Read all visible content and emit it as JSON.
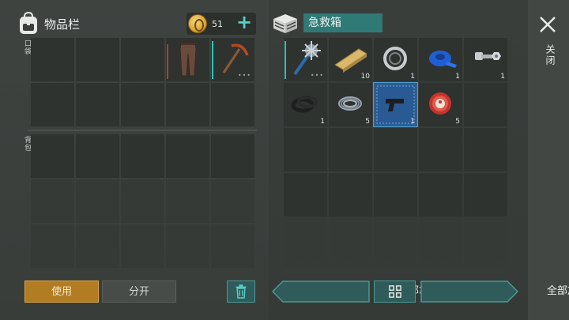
{
  "inventory": {
    "title": "物品栏",
    "pocket_label": "口袋",
    "backpack_label": "背包",
    "coins": "51",
    "pocket_slots": [
      {
        "item": "",
        "qty": ""
      },
      {
        "item": "",
        "qty": ""
      },
      {
        "item": "",
        "qty": ""
      },
      {
        "item": "leather-pants-icon",
        "qty": "",
        "bar": "red"
      },
      {
        "item": "pickaxe-icon",
        "qty": "",
        "bar": "teal",
        "dots": "•••"
      },
      {
        "item": "",
        "qty": ""
      },
      {
        "item": "",
        "qty": ""
      },
      {
        "item": "",
        "qty": ""
      },
      {
        "item": "",
        "qty": ""
      },
      {
        "item": "",
        "qty": ""
      }
    ],
    "backpack_slots": 15
  },
  "container": {
    "title": "急救箱",
    "slots": [
      {
        "item": "spiked-mace-icon",
        "qty": "",
        "bar": "teal",
        "dots": "•••"
      },
      {
        "item": "wood-plank-icon",
        "qty": "10"
      },
      {
        "item": "bearing-icon",
        "qty": "1"
      },
      {
        "item": "blue-tape-icon",
        "qty": "1"
      },
      {
        "item": "nut-bolt-icon",
        "qty": "1"
      },
      {
        "item": "rubber-ring-icon",
        "qty": "1"
      },
      {
        "item": "wire-coil-icon",
        "qty": "5"
      },
      {
        "item": "pistol-blueprint-icon",
        "qty": "1",
        "selected": true
      },
      {
        "item": "bottle-cap-icon",
        "qty": "5"
      },
      {
        "item": "",
        "qty": ""
      }
    ],
    "empty_rows": 4
  },
  "buttons": {
    "use": "使用",
    "split": "分开",
    "take_all": "全部拿上",
    "put_all": "全部放入",
    "close": "关闭"
  },
  "colors": {
    "accent_teal": "#2f7a77",
    "use_button": "#b27d22",
    "selected_slot": "#2e5e8e"
  }
}
